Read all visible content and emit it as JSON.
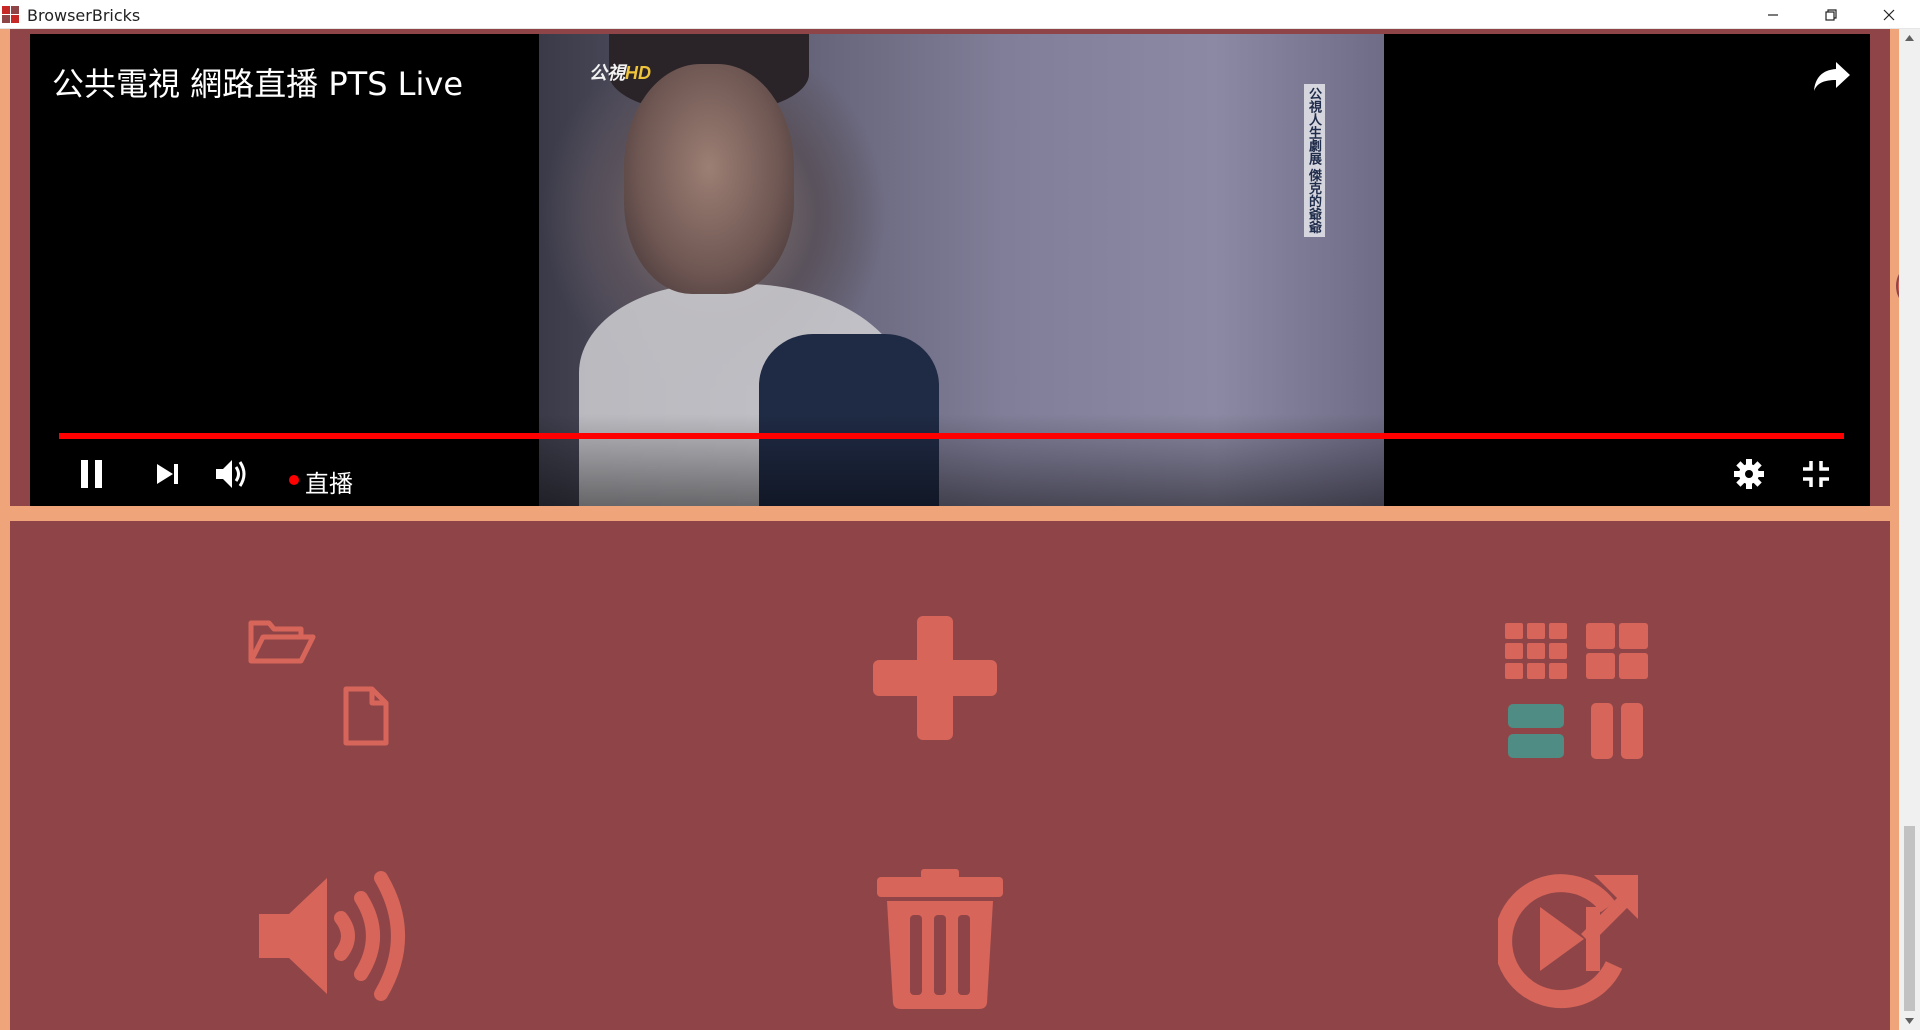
{
  "window": {
    "title": "BrowserBricks",
    "minimize_label": "minimize",
    "restore_label": "restore",
    "close_label": "close"
  },
  "player": {
    "title": "公共電視 網路直播 PTS Live",
    "live_label": "直播",
    "channel_logo": "公視",
    "channel_logo_hd": "HD",
    "caption_vertical": "公視人生劇展 傑克的爺爺",
    "progress": 1.0
  },
  "colors": {
    "panel": "#8f4548",
    "accent": "#d7655a",
    "frame_border": "#f0a47a",
    "teal": "#4f8d84",
    "progress": "#ff0000"
  },
  "icons": {
    "share": "share-icon",
    "pause": "pause-icon",
    "next": "next-icon",
    "volume": "volume-icon",
    "settings": "gear-icon",
    "exit_fullscreen": "exit-fullscreen-icon",
    "open_folder": "folder-open-icon",
    "new_file": "file-icon",
    "add": "plus-icon",
    "grid_small": "grid-9-icon",
    "grid_large": "grid-4-icon",
    "rows": "rows-icon",
    "columns": "columns-icon",
    "sound": "volume-up-icon",
    "trash": "trash-icon",
    "autoplay": "autoplay-icon"
  }
}
